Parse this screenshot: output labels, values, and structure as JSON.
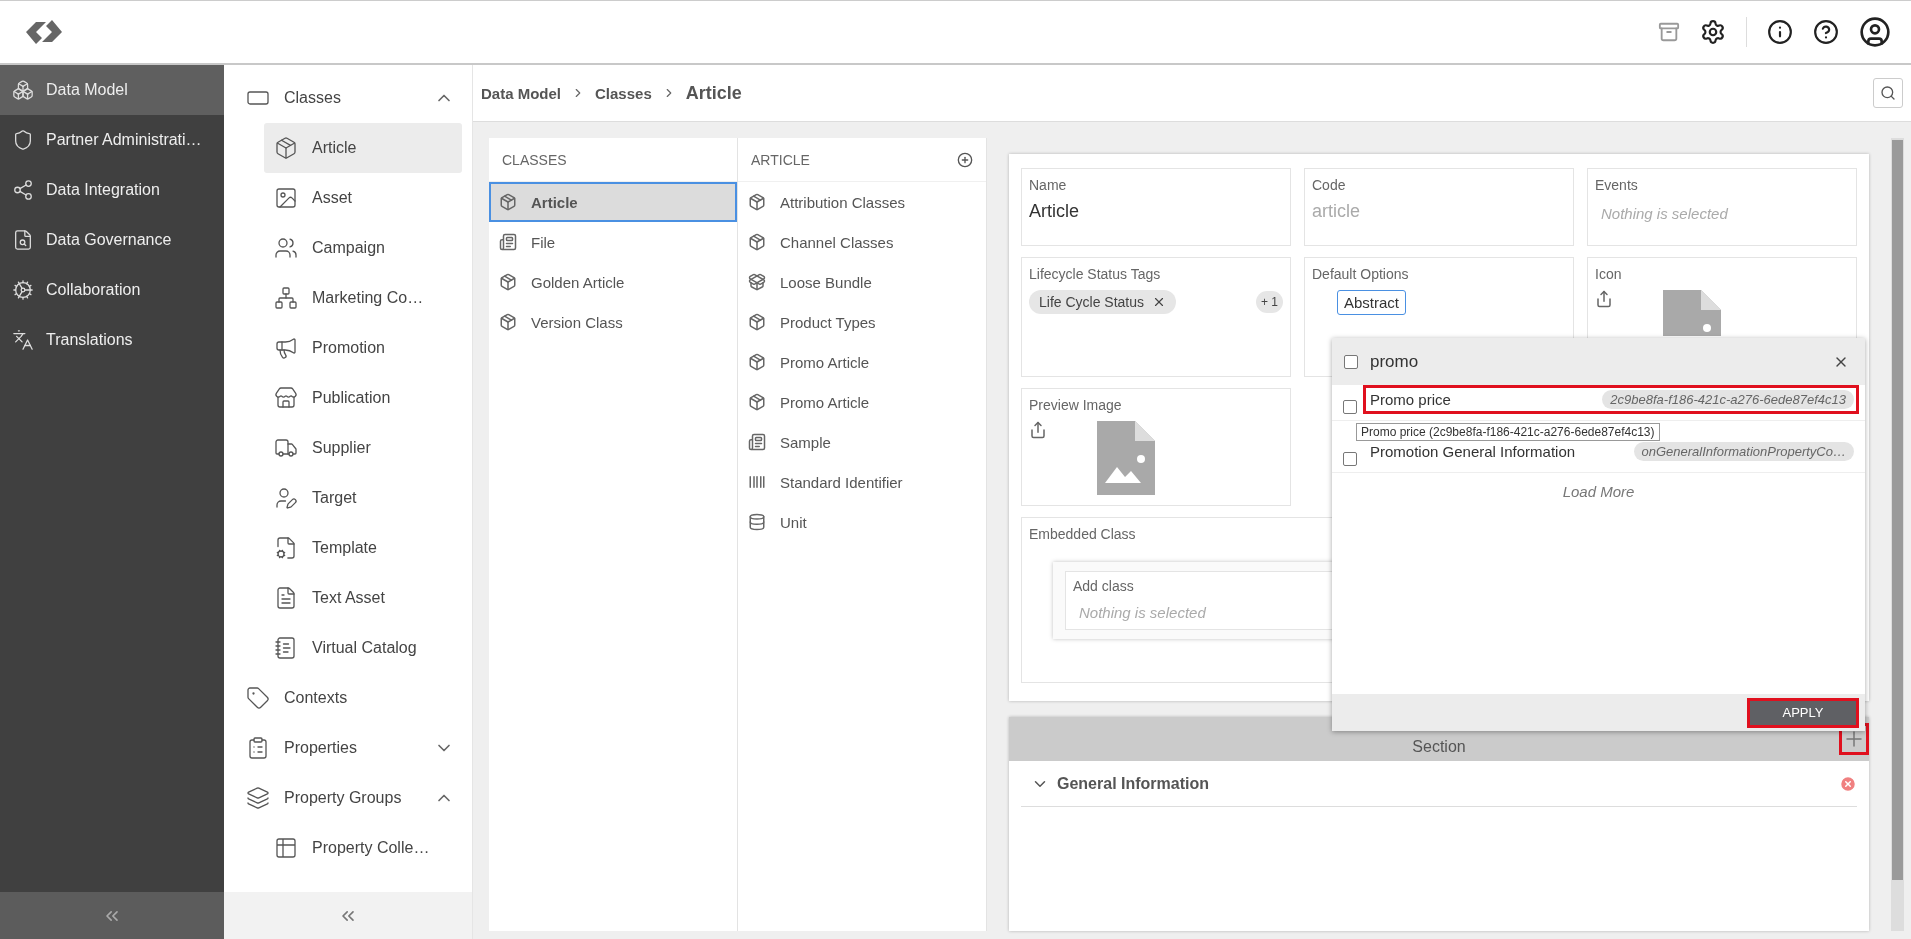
{
  "main_nav": [
    {
      "label": "Data Model",
      "selected": true
    },
    {
      "label": "Partner Administrati…",
      "selected": false
    },
    {
      "label": "Data Integration",
      "selected": false
    },
    {
      "label": "Data Governance",
      "selected": false
    },
    {
      "label": "Collaboration",
      "selected": false
    },
    {
      "label": "Translations",
      "selected": false
    }
  ],
  "sub_nav": [
    {
      "label": "Classes",
      "selected": false,
      "expanded": true,
      "children": [
        {
          "label": "Article",
          "selected": true
        },
        {
          "label": "Asset",
          "selected": false
        },
        {
          "label": "Campaign",
          "selected": false
        },
        {
          "label": "Marketing Co…",
          "selected": false
        },
        {
          "label": "Promotion",
          "selected": false
        },
        {
          "label": "Publication",
          "selected": false
        },
        {
          "label": "Supplier",
          "selected": false
        },
        {
          "label": "Target",
          "selected": false
        },
        {
          "label": "Template",
          "selected": false
        },
        {
          "label": "Text Asset",
          "selected": false
        },
        {
          "label": "Virtual Catalog",
          "selected": false
        }
      ]
    },
    {
      "label": "Contexts",
      "selected": false
    },
    {
      "label": "Properties",
      "selected": false,
      "expanded": false
    },
    {
      "label": "Property Groups",
      "selected": false,
      "expanded": true,
      "children": [
        {
          "label": "Property Colle…",
          "selected": false
        }
      ]
    }
  ],
  "breadcrumb": [
    "Data Model",
    "Classes",
    "Article"
  ],
  "classes_panel": {
    "title": "CLASSES",
    "items": [
      {
        "label": "Article",
        "selected": true
      },
      {
        "label": "File",
        "selected": false
      },
      {
        "label": "Golden Article",
        "selected": false
      },
      {
        "label": "Version Class",
        "selected": false
      }
    ]
  },
  "article_panel": {
    "title": "ARTICLE",
    "items": [
      {
        "label": "Attribution Classes"
      },
      {
        "label": "Channel Classes"
      },
      {
        "label": "Loose Bundle"
      },
      {
        "label": "Product Types"
      },
      {
        "label": "Promo Article"
      },
      {
        "label": "Promo Article"
      },
      {
        "label": "Sample"
      },
      {
        "label": "Standard Identifier"
      },
      {
        "label": "Unit"
      }
    ]
  },
  "form": {
    "fields": [
      {
        "kind": "text",
        "label": "Name",
        "value": "Article",
        "disabled": false
      },
      {
        "kind": "text",
        "label": "Code",
        "value": "article",
        "disabled": true
      },
      {
        "kind": "select",
        "label": "Events",
        "placeholder": "Nothing is selected"
      },
      {
        "kind": "tags",
        "label": "Lifecycle Status Tags",
        "tags": [
          "Life Cycle Status"
        ],
        "more": "+ 1"
      },
      {
        "kind": "options",
        "label": "Default Options",
        "options": [
          {
            "label": "Abstract",
            "selected": true
          }
        ]
      },
      {
        "kind": "image",
        "label": "Icon"
      },
      {
        "kind": "image",
        "label": "Preview Image"
      },
      {
        "kind": "embedded",
        "label": "Embedded Class",
        "field_label": "Add class",
        "placeholder": "Nothing is selected"
      }
    ]
  },
  "dropdown": {
    "search": "promo",
    "checked": false,
    "options": [
      {
        "label": "Promo price",
        "id": "2c9be8fa-f186-421c-a276-6ede87ef4c13",
        "checked": false,
        "highlighted": true
      },
      {
        "label": "Promotion General Information",
        "id": "onGeneralInformationPropertyCo…",
        "checked": false,
        "highlighted": false
      }
    ],
    "tooltip": "Promo price (2c9be8fa-f186-421c-a276-6ede87ef4c13)",
    "load_more": "Load More",
    "apply": "APPLY"
  },
  "section": {
    "title": "Section",
    "groups": [
      {
        "title": "General Information",
        "expanded": true
      }
    ]
  }
}
